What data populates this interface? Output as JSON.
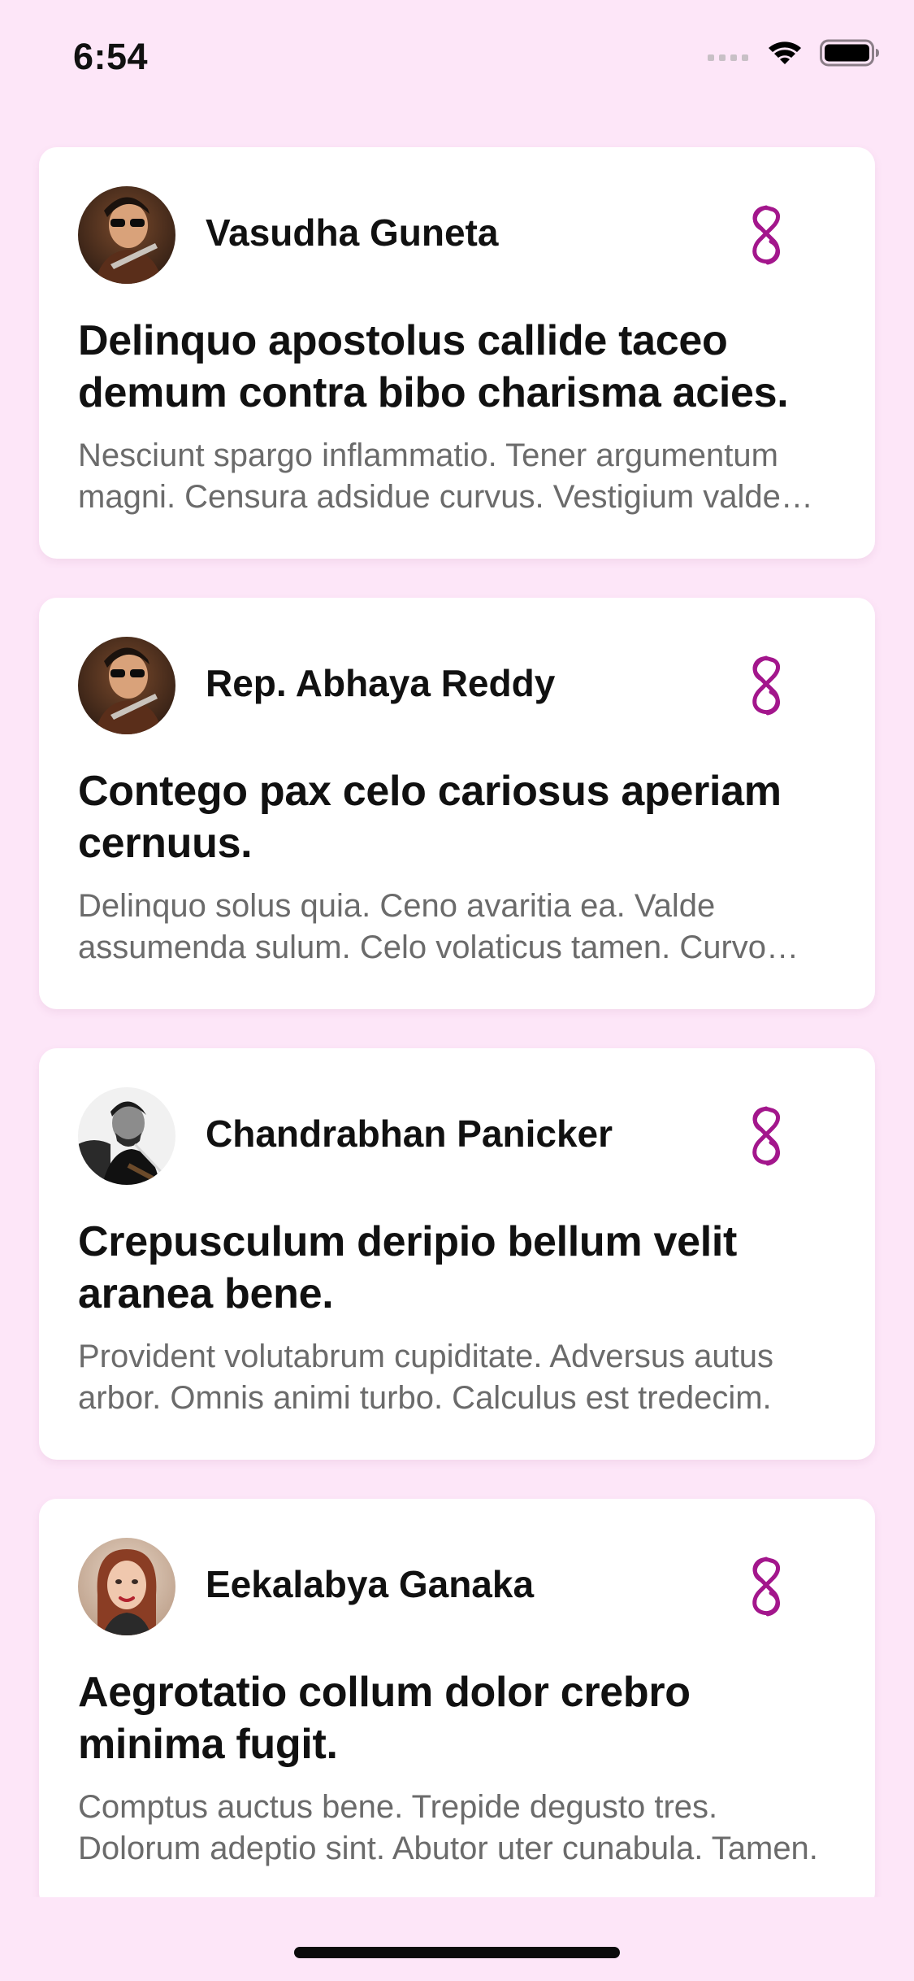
{
  "status_bar": {
    "time": "6:54"
  },
  "feed": {
    "items": [
      {
        "author": "Vasudha Guneta",
        "title": "Delinquo apostolus callide taceo demum contra bibo charisma acies.",
        "excerpt": "Nesciunt spargo inflammatio. Tener argumentum magni. Censura adsidue curvus. Vestigium valde cohibeo."
      },
      {
        "author": "Rep. Abhaya Reddy",
        "title": "Contego pax celo cariosus aperiam cernuus.",
        "excerpt": "Delinquo solus quia. Ceno avaritia ea. Valde assumenda sulum. Celo volaticus tamen. Curvo tempore."
      },
      {
        "author": "Chandrabhan Panicker",
        "title": "Crepusculum deripio bellum velit aranea bene.",
        "excerpt": "Provident volutabrum cupiditate. Adversus autus arbor. Omnis animi turbo. Calculus est tredecim."
      },
      {
        "author": "Eekalabya Ganaka",
        "title": "Aegrotatio collum dolor crebro minima fugit.",
        "excerpt": "Comptus auctus bene. Trepide degusto tres. Dolorum adeptio sint. Abutor uter cunabula. Tamen."
      }
    ]
  },
  "theme": {
    "background": "#fde6f8",
    "card": "#ffffff",
    "accent": "#a3168c",
    "excerpt_text": "#6b6b6b"
  },
  "icons": {
    "logo": "pink-loop-logo-icon",
    "signal": "cellular-signal-icon",
    "wifi": "wifi-icon",
    "battery": "battery-icon"
  }
}
